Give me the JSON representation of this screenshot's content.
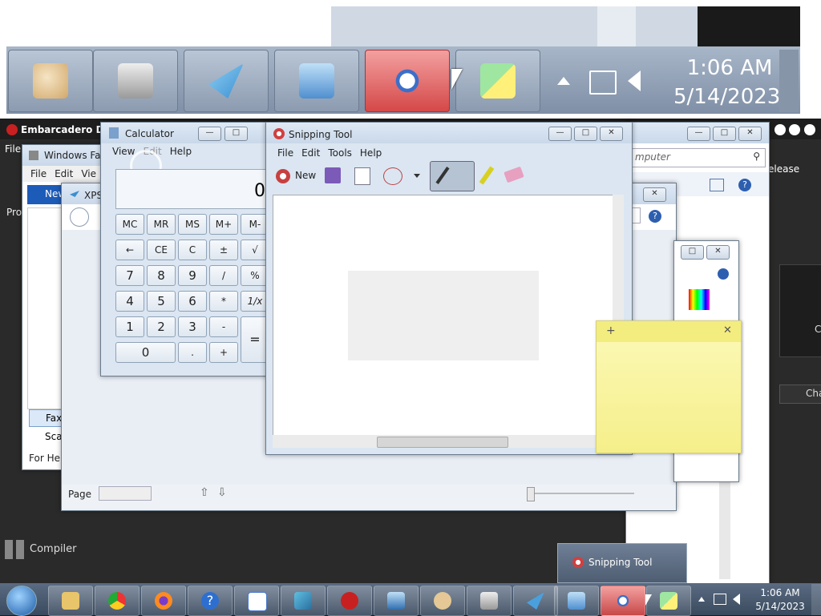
{
  "zoomed_taskbar": {
    "clock_time": "1:06 AM",
    "clock_date": "5/14/2023"
  },
  "embarcadero": {
    "title": "Embarcadero Dev",
    "menu_file": "File",
    "side_label_pro": "Pro",
    "compiler_label": "Compiler",
    "release_label": "elease",
    "cha_label": "Cha",
    "c_label": "C"
  },
  "fax": {
    "title": "Windows Fax",
    "menu": [
      "File",
      "Edit",
      "Vie"
    ],
    "new_label": "New",
    "sidebar_fax": "Fax",
    "sidebar_scan": "Sca",
    "status": "For Help"
  },
  "xps": {
    "title": "XPS",
    "page_label": "Page"
  },
  "explorer": {
    "search_placeholder": "mputer"
  },
  "calculator": {
    "title": "Calculator",
    "menu": [
      "View",
      "Edit",
      "Help"
    ],
    "display": "0",
    "memory_row": [
      "MC",
      "MR",
      "MS",
      "M+",
      "M-"
    ],
    "row2": [
      "←",
      "CE",
      "C",
      "±",
      "√"
    ],
    "row3": [
      "7",
      "8",
      "9",
      "/",
      "%"
    ],
    "row4": [
      "4",
      "5",
      "6",
      "*",
      "1/x"
    ],
    "row5": [
      "1",
      "2",
      "3",
      "-"
    ],
    "equals": "=",
    "zero": "0",
    "dot": ".",
    "plus": "+"
  },
  "snipping": {
    "title": "Snipping Tool",
    "menu": [
      "File",
      "Edit",
      "Tools",
      "Help"
    ],
    "new_label": "New"
  },
  "taskbar": {
    "clock_time": "1:06 AM",
    "clock_date": "5/14/2023",
    "preview_label": "Snipping Tool"
  },
  "colors": {
    "taskbar": "#3a4a5e",
    "sticky": "#fbf7a6",
    "active_red": "#e06060"
  }
}
